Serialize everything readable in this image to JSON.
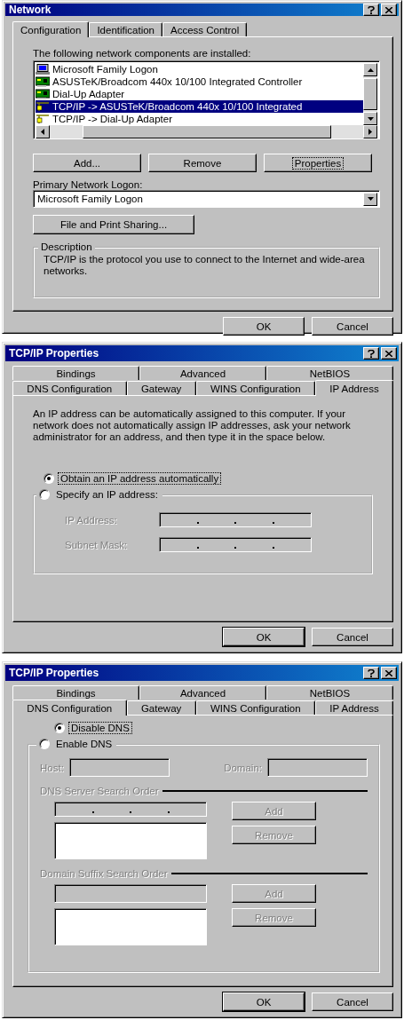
{
  "network": {
    "title": "Network",
    "tabs": [
      {
        "label": "Configuration",
        "selected": true
      },
      {
        "label": "Identification",
        "selected": false
      },
      {
        "label": "Access Control",
        "selected": false
      }
    ],
    "list_label": "The following network components are installed:",
    "components": [
      {
        "label": "Microsoft Family Logon",
        "kind": "client",
        "selected": false
      },
      {
        "label": "ASUSTeK/Broadcom 440x 10/100 Integrated Controller",
        "kind": "adapter",
        "selected": false
      },
      {
        "label": "Dial-Up Adapter",
        "kind": "adapter",
        "selected": false
      },
      {
        "label": "TCP/IP -> ASUSTeK/Broadcom 440x 10/100 Integrated",
        "kind": "protocol",
        "selected": true
      },
      {
        "label": "TCP/IP -> Dial-Up Adapter",
        "kind": "protocol",
        "selected": false
      }
    ],
    "actions": [
      {
        "label": "Add...",
        "focused": false
      },
      {
        "label": "Remove",
        "focused": false
      },
      {
        "label": "Properties",
        "focused": true
      }
    ],
    "logon": {
      "label": "Primary Network Logon:",
      "value": "Microsoft Family Logon"
    },
    "sharing_button": "File and Print Sharing...",
    "description": {
      "legend": "Description",
      "text": "TCP/IP is the protocol you use to connect to the Internet and wide-area networks."
    },
    "footer": [
      {
        "label": "OK",
        "default": false
      },
      {
        "label": "Cancel",
        "default": false
      }
    ]
  },
  "tcpip_ip": {
    "title": "TCP/IP Properties",
    "tab_rows": [
      [
        {
          "label": "Bindings",
          "selected": false
        },
        {
          "label": "Advanced",
          "selected": false
        },
        {
          "label": "NetBIOS",
          "selected": false
        }
      ],
      [
        {
          "label": "DNS Configuration",
          "selected": false
        },
        {
          "label": "Gateway",
          "selected": false
        },
        {
          "label": "WINS Configuration",
          "selected": false
        },
        {
          "label": "IP Address",
          "selected": true
        }
      ]
    ],
    "intro": "An IP address can be automatically assigned to this computer. If your network does not automatically assign IP addresses, ask your network administrator for an address, and then type it in the space below.",
    "options": [
      {
        "label": "Obtain an IP address automatically",
        "selected": true,
        "focused": true
      },
      {
        "label": "Specify an IP address:",
        "selected": false,
        "focused": false
      }
    ],
    "fields": [
      {
        "label": "IP Address:",
        "disabled": true
      },
      {
        "label": "Subnet Mask:",
        "disabled": true
      }
    ],
    "footer": [
      {
        "label": "OK",
        "default": true
      },
      {
        "label": "Cancel",
        "default": false
      }
    ]
  },
  "tcpip_dns": {
    "title": "TCP/IP Properties",
    "tab_rows": [
      [
        {
          "label": "Bindings",
          "selected": false
        },
        {
          "label": "Advanced",
          "selected": false
        },
        {
          "label": "NetBIOS",
          "selected": false
        }
      ],
      [
        {
          "label": "DNS Configuration",
          "selected": true
        },
        {
          "label": "Gateway",
          "selected": false
        },
        {
          "label": "WINS Configuration",
          "selected": false
        },
        {
          "label": "IP Address",
          "selected": false
        }
      ]
    ],
    "options": [
      {
        "label": "Disable DNS",
        "selected": true,
        "focused": true
      },
      {
        "label": "Enable DNS",
        "selected": false,
        "focused": false
      }
    ],
    "host": {
      "label": "Host:",
      "disabled": true
    },
    "domain": {
      "label": "Domain:",
      "disabled": true
    },
    "server_order": {
      "legend": "DNS Server Search Order",
      "disabled": true,
      "buttons": [
        {
          "label": "Add",
          "disabled": true
        },
        {
          "label": "Remove",
          "disabled": true
        }
      ]
    },
    "suffix_order": {
      "legend": "Domain Suffix Search Order",
      "disabled": true,
      "buttons": [
        {
          "label": "Add",
          "disabled": true
        },
        {
          "label": "Remove",
          "disabled": true
        }
      ]
    },
    "footer": [
      {
        "label": "OK",
        "default": true
      },
      {
        "label": "Cancel",
        "default": false
      }
    ]
  }
}
